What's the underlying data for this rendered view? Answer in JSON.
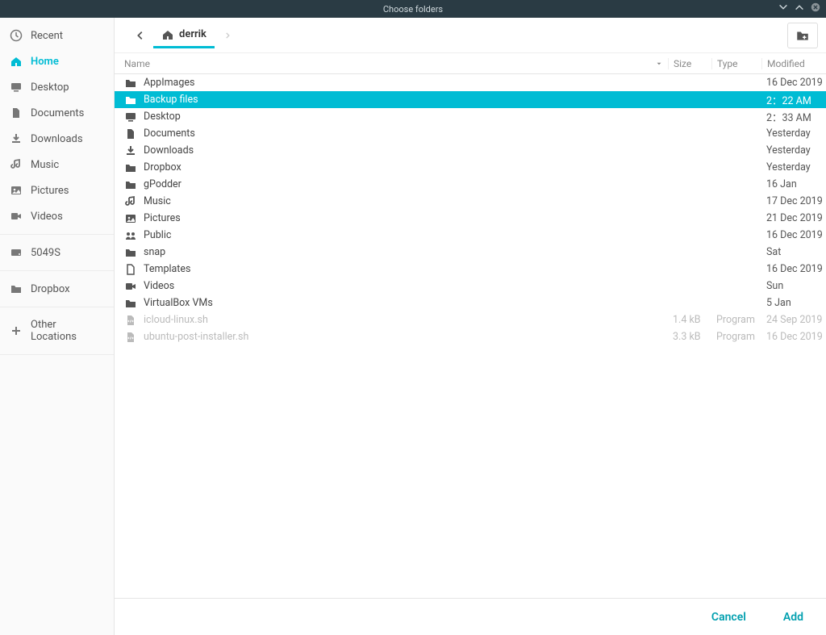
{
  "title": "Choose folders",
  "sidebar": {
    "sections": [
      {
        "items": [
          {
            "label": "Recent",
            "icon": "clock"
          },
          {
            "label": "Home",
            "icon": "home",
            "active": true
          },
          {
            "label": "Desktop",
            "icon": "desktop"
          },
          {
            "label": "Documents",
            "icon": "document"
          },
          {
            "label": "Downloads",
            "icon": "download"
          },
          {
            "label": "Music",
            "icon": "music"
          },
          {
            "label": "Pictures",
            "icon": "image"
          },
          {
            "label": "Videos",
            "icon": "video"
          }
        ]
      },
      {
        "items": [
          {
            "label": "5049S",
            "icon": "drive"
          }
        ]
      },
      {
        "items": [
          {
            "label": "Dropbox",
            "icon": "folder"
          }
        ]
      },
      {
        "items": [
          {
            "label": "Other Locations",
            "icon": "plus"
          }
        ]
      }
    ]
  },
  "breadcrumb": {
    "label": "derrik",
    "icon": "home"
  },
  "columns": {
    "name": "Name",
    "size": "Size",
    "type": "Type",
    "modified": "Modified",
    "sort": "name-desc"
  },
  "rows": [
    {
      "name": "AppImages",
      "icon": "folder",
      "size": "",
      "type": "",
      "modified": "16 Dec 2019"
    },
    {
      "name": "Backup files",
      "icon": "folder",
      "size": "",
      "type": "",
      "modified": "2：22 AM",
      "selected": true
    },
    {
      "name": "Desktop",
      "icon": "desktop",
      "size": "",
      "type": "",
      "modified": "2：33 AM"
    },
    {
      "name": "Documents",
      "icon": "document",
      "size": "",
      "type": "",
      "modified": "Yesterday"
    },
    {
      "name": "Downloads",
      "icon": "download",
      "size": "",
      "type": "",
      "modified": "Yesterday"
    },
    {
      "name": "Dropbox",
      "icon": "folder",
      "size": "",
      "type": "",
      "modified": "Yesterday"
    },
    {
      "name": "gPodder",
      "icon": "folder",
      "size": "",
      "type": "",
      "modified": "16 Jan"
    },
    {
      "name": "Music",
      "icon": "music",
      "size": "",
      "type": "",
      "modified": "17 Dec 2019"
    },
    {
      "name": "Pictures",
      "icon": "image",
      "size": "",
      "type": "",
      "modified": "21 Dec 2019"
    },
    {
      "name": "Public",
      "icon": "public",
      "size": "",
      "type": "",
      "modified": "16 Dec 2019"
    },
    {
      "name": "snap",
      "icon": "folder",
      "size": "",
      "type": "",
      "modified": "Sat"
    },
    {
      "name": "Templates",
      "icon": "template",
      "size": "",
      "type": "",
      "modified": "16 Dec 2019"
    },
    {
      "name": "Videos",
      "icon": "video",
      "size": "",
      "type": "",
      "modified": "Sun"
    },
    {
      "name": "VirtualBox VMs",
      "icon": "folder",
      "size": "",
      "type": "",
      "modified": "5 Jan"
    },
    {
      "name": "icloud-linux.sh",
      "icon": "script",
      "size": "1.4 kB",
      "type": "Program",
      "modified": "24 Sep 2019",
      "dim": true
    },
    {
      "name": "ubuntu-post-installer.sh",
      "icon": "script",
      "size": "3.3 kB",
      "type": "Program",
      "modified": "16 Dec 2019",
      "dim": true
    }
  ],
  "footer": {
    "cancel": "Cancel",
    "add": "Add"
  }
}
